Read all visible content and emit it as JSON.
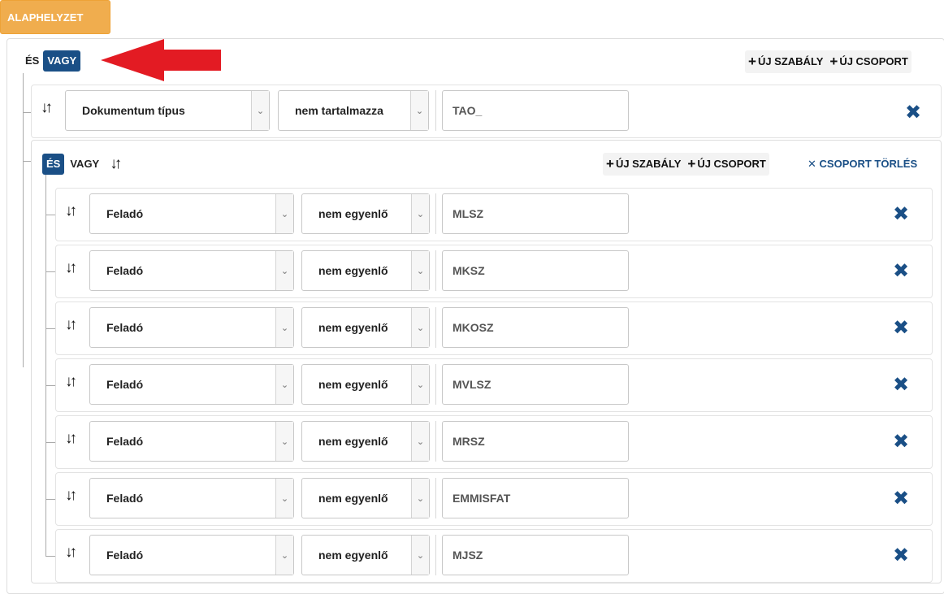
{
  "reset_button": {
    "label": "ALAPHELYZET"
  },
  "outer_group": {
    "and_label": "ÉS",
    "or_label": "VAGY",
    "active_conjunction": "VAGY",
    "add_rule_label": "ÚJ SZABÁLY",
    "add_group_label": "ÚJ CSOPORT",
    "plus_glyph": "+",
    "rule": {
      "field": "Dokumentum típus",
      "operator": "nem tartalmazza",
      "value": "TAO_"
    }
  },
  "inner_group": {
    "and_label": "ÉS",
    "or_label": "VAGY",
    "active_conjunction": "ÉS",
    "add_rule_label": "ÚJ SZABÁLY",
    "add_group_label": "ÚJ CSOPORT",
    "delete_group_label": "CSOPORT TÖRLÉS",
    "rules": [
      {
        "field": "Feladó",
        "operator": "nem egyenlő",
        "value": "MLSZ"
      },
      {
        "field": "Feladó",
        "operator": "nem egyenlő",
        "value": "MKSZ"
      },
      {
        "field": "Feladó",
        "operator": "nem egyenlő",
        "value": "MKOSZ"
      },
      {
        "field": "Feladó",
        "operator": "nem egyenlő",
        "value": "MVLSZ"
      },
      {
        "field": "Feladó",
        "operator": "nem egyenlő",
        "value": "MRSZ"
      },
      {
        "field": "Feladó",
        "operator": "nem egyenlő",
        "value": "EMMISFAT"
      },
      {
        "field": "Feladó",
        "operator": "nem egyenlő",
        "value": "MJSZ"
      }
    ]
  },
  "icons": {
    "sort": "sort-arrows-icon",
    "delete": "close-x-icon",
    "caret": "chevron-down-icon",
    "annotation": "red-arrow-pointer"
  },
  "colors": {
    "reset_button": "#f0ad4e",
    "active_conjunction": "#1a4f86",
    "delete_icon": "#1a4f86",
    "annotation_arrow": "#e31b23"
  }
}
